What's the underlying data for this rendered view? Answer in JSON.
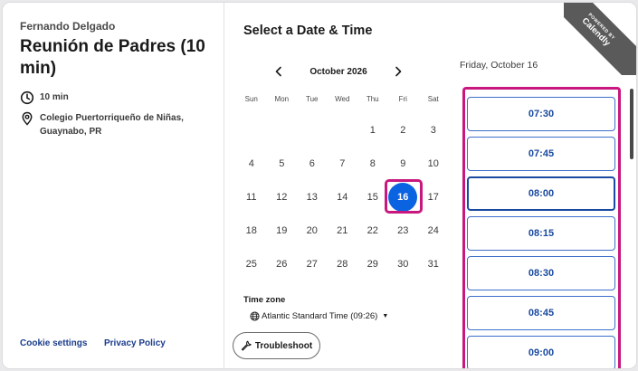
{
  "event": {
    "organizer": "Fernando Delgado",
    "title": "Reunión de Padres (10 min)",
    "duration": "10 min",
    "location": "Colegio Puertorriqueño de Niñas, Guaynabo, PR"
  },
  "footer": {
    "cookie_label": "Cookie settings",
    "privacy_label": "Privacy Policy"
  },
  "calendar": {
    "heading": "Select a Date & Time",
    "month_label": "October 2026",
    "weekdays": [
      "Sun",
      "Mon",
      "Tue",
      "Wed",
      "Thu",
      "Fri",
      "Sat"
    ],
    "selected_day": "16",
    "selected_date_label": "Friday, October 16"
  },
  "timezone": {
    "label": "Time zone",
    "value": "Atlantic Standard Time (09:26)"
  },
  "troubleshoot_label": "Troubleshoot",
  "slots": [
    "07:30",
    "07:45",
    "08:00",
    "08:15",
    "08:30",
    "08:45",
    "09:00"
  ],
  "ribbon": {
    "powered": "POWERED BY",
    "brand": "Calendly"
  },
  "colors": {
    "accent": "#0a63e0",
    "highlight": "#c8187f",
    "slot_text": "#1a4aa0"
  }
}
